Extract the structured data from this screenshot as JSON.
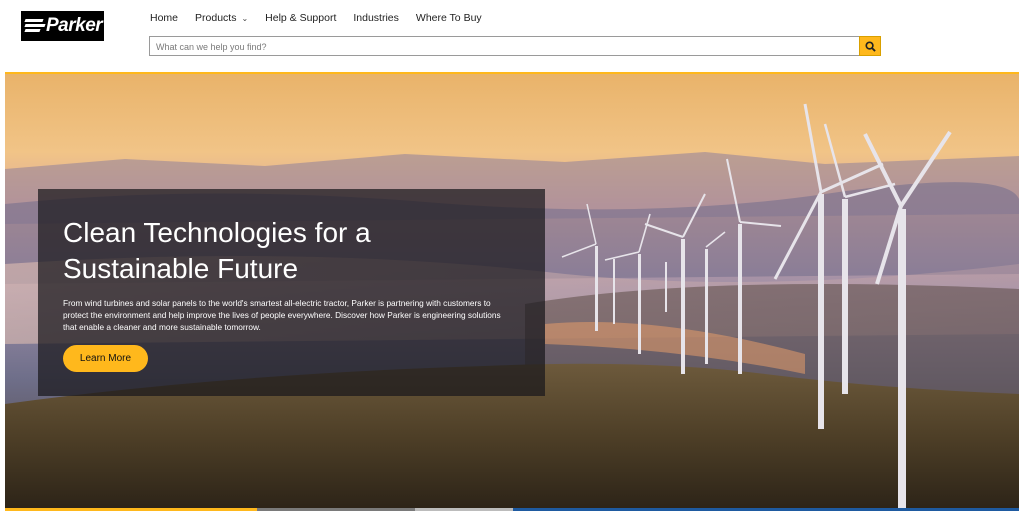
{
  "brand": {
    "logo_text": "Parker"
  },
  "nav": {
    "items": [
      {
        "label": "Home"
      },
      {
        "label": "Products"
      },
      {
        "label": "Help & Support"
      },
      {
        "label": "Industries"
      },
      {
        "label": "Where To Buy"
      }
    ]
  },
  "search": {
    "placeholder": "What can we help you find?",
    "value": ""
  },
  "hero": {
    "title": "Clean Technologies for a Sustainable Future",
    "description": "From wind turbines and solar panels to the world's smartest all-electric tractor, Parker is partnering with customers to protect the environment and help improve the lives of people everywhere. Discover how Parker is engineering solutions that enable a cleaner and more sustainable tomorrow.",
    "cta_label": "Learn More"
  },
  "icons": {
    "search": "search-icon",
    "products_dropdown": "chevron-down-icon"
  },
  "colors": {
    "accent": "#ffb81c",
    "logo_bg": "#000000",
    "panel_bg": "#19181c"
  }
}
